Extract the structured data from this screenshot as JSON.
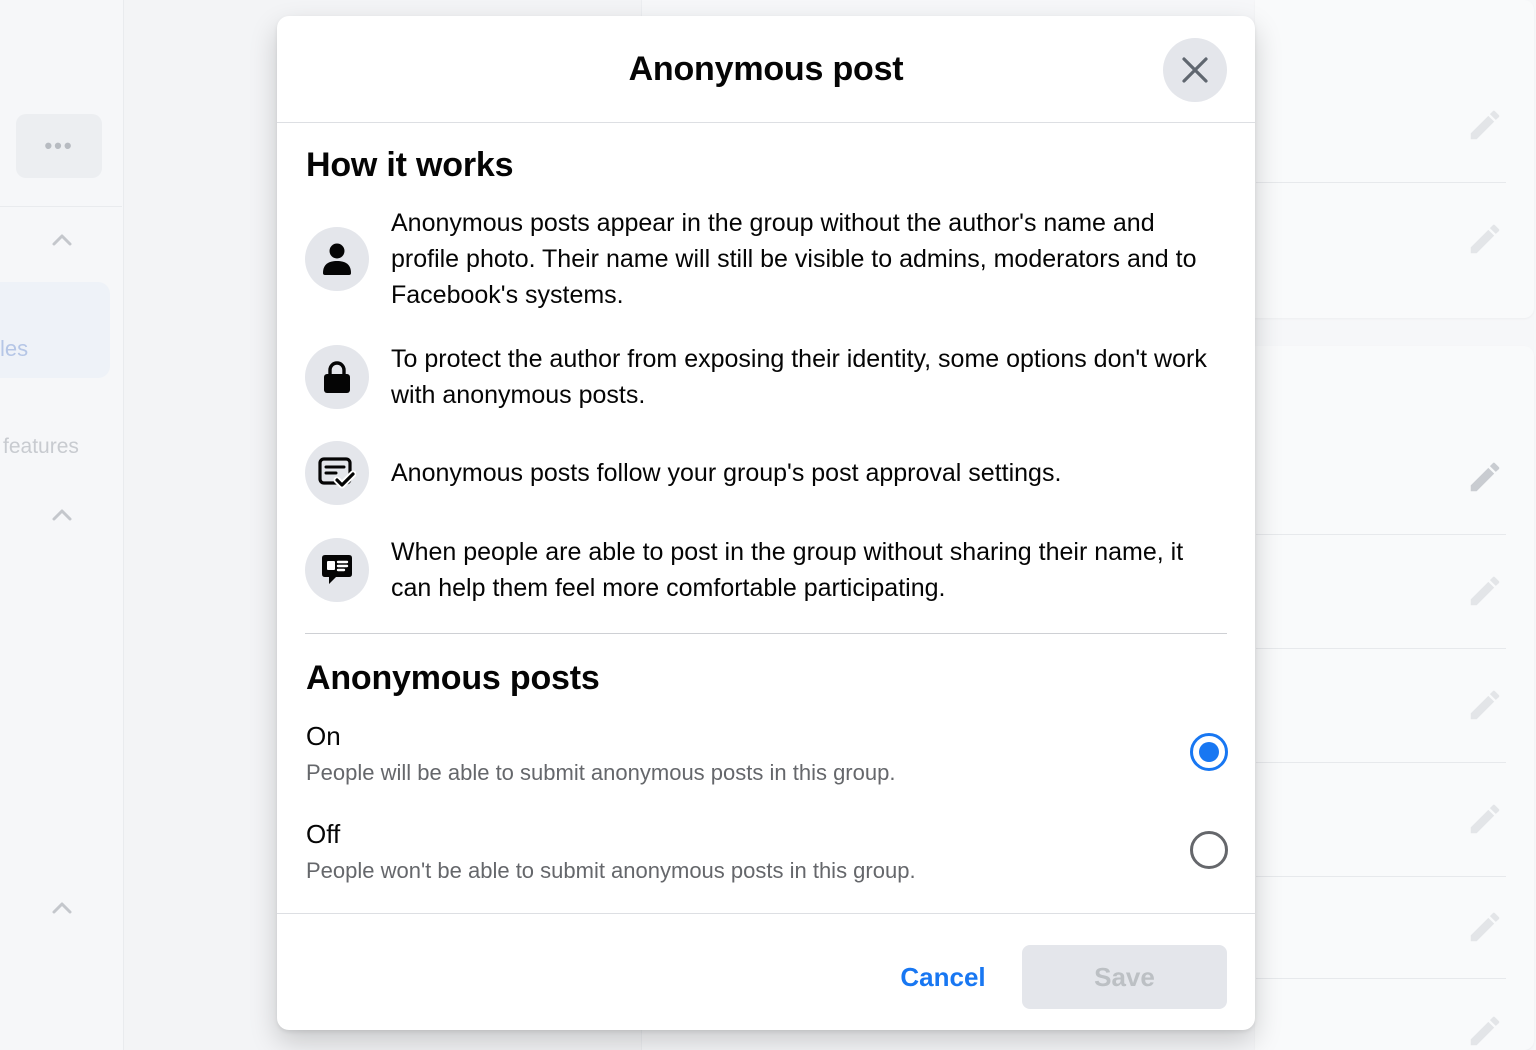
{
  "background": {
    "more_label": "•••",
    "sidebar_selected_label": "les",
    "sidebar_section_label": "features"
  },
  "modal": {
    "title": "Anonymous post",
    "close_icon": "close-icon",
    "how_it_works": {
      "heading": "How it works",
      "items": [
        {
          "icon": "person-icon",
          "text": "Anonymous posts appear in the group without the author's name and profile photo. Their name will still be visible to admins, moderators and to Facebook's systems."
        },
        {
          "icon": "lock-icon",
          "text": "To protect the author from exposing their identity, some options don't work with anonymous posts."
        },
        {
          "icon": "post-approval-icon",
          "text": "Anonymous posts follow your group's post approval settings."
        },
        {
          "icon": "comment-icon",
          "text": "When people are able to post in the group without sharing their name, it can help them feel more comfortable participating."
        }
      ]
    },
    "setting": {
      "heading": "Anonymous posts",
      "selected": "on",
      "options": [
        {
          "label": "On",
          "description": "People will be able to submit anonymous posts in this group."
        },
        {
          "label": "Off",
          "description": "People won't be able to submit anonymous posts in this group."
        }
      ]
    },
    "footer": {
      "cancel_label": "Cancel",
      "save_label": "Save"
    }
  },
  "colors": {
    "accent": "#1877f2",
    "secondary_text": "#65676b",
    "icon_bg": "#e4e6eb",
    "disabled_text": "#bcc0c4"
  }
}
